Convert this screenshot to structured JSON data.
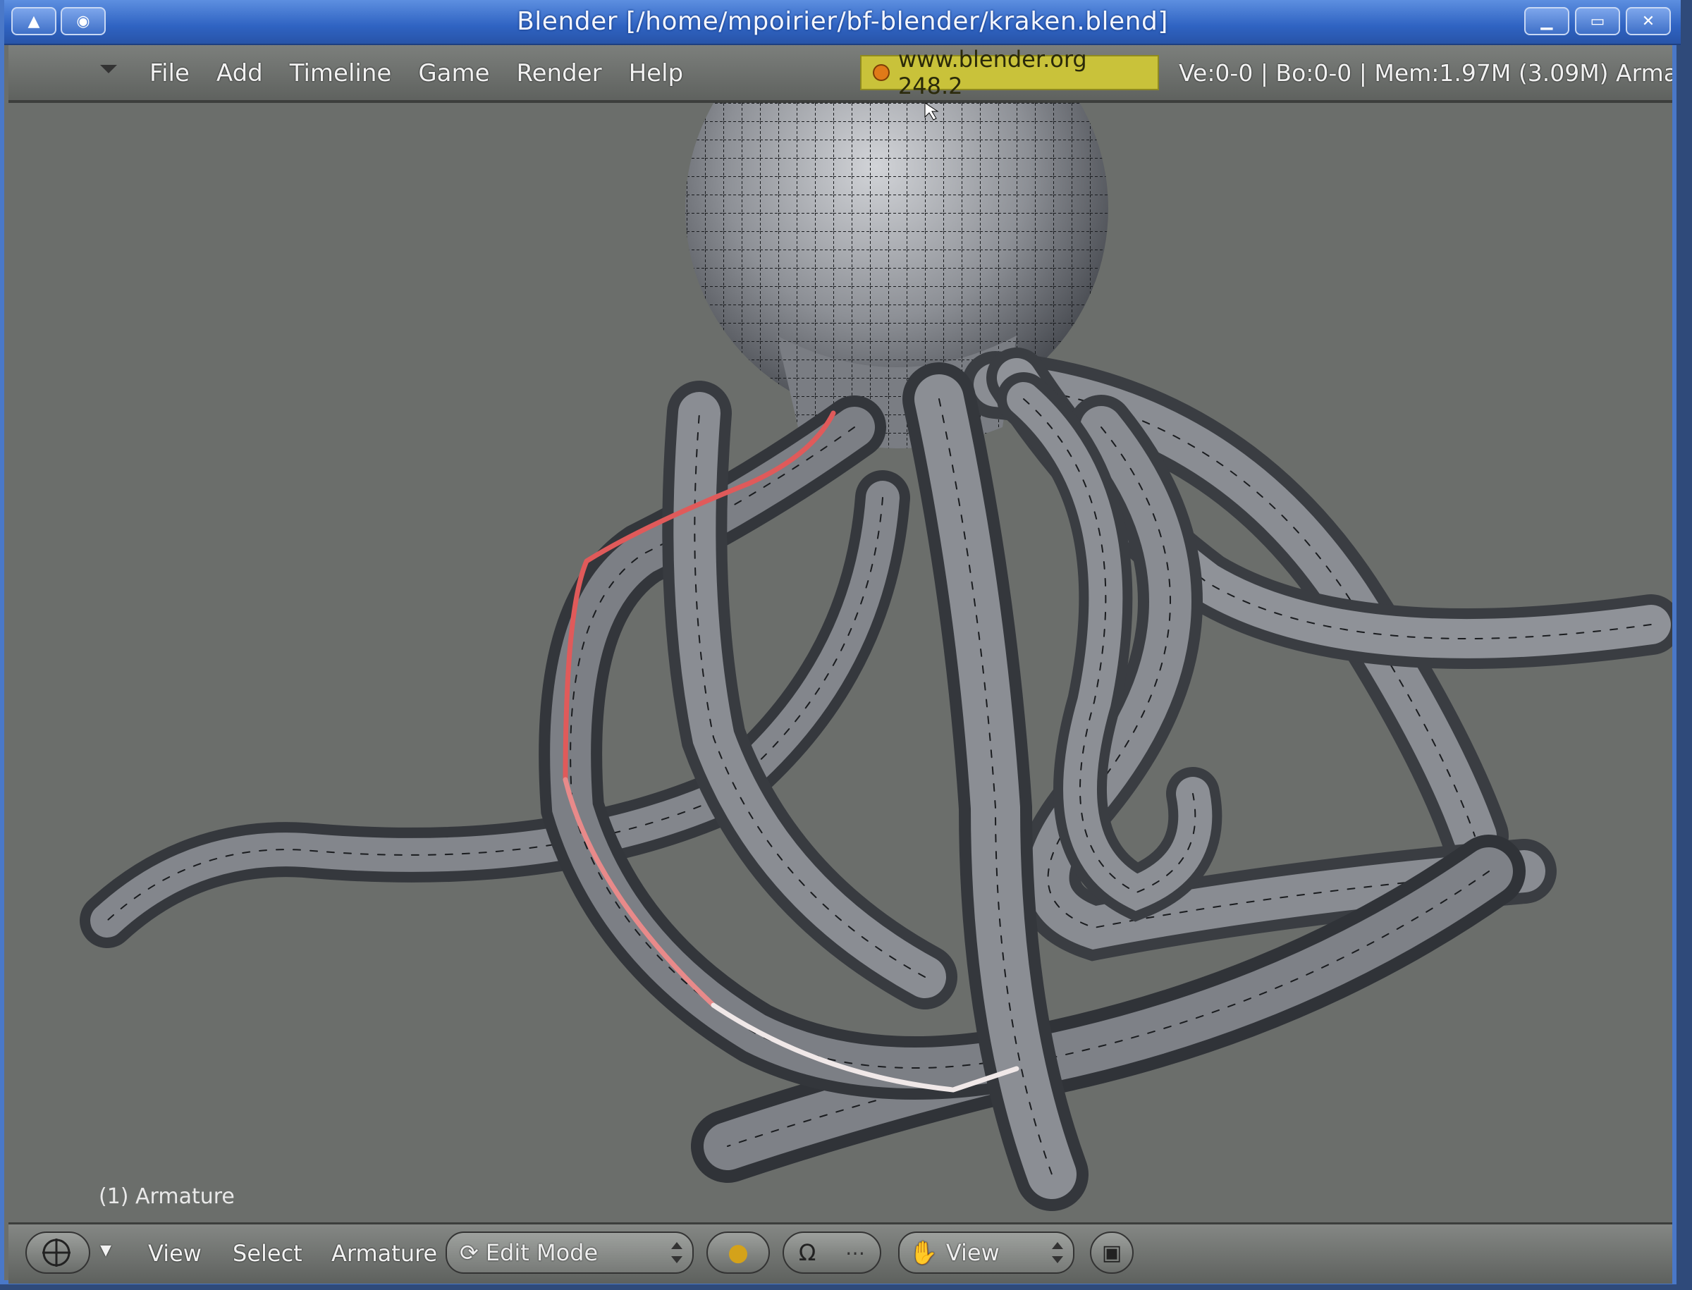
{
  "window": {
    "title": "Blender [/home/mpoirier/bf-blender/kraken.blend]"
  },
  "menubar": {
    "menus": [
      "File",
      "Add",
      "Timeline",
      "Game",
      "Render",
      "Help"
    ],
    "url_badge": "www.blender.org 248.2",
    "stats": "Ve:0-0 | Bo:0-0 | Mem:1.97M (3.09M) Arma"
  },
  "viewport": {
    "object_label": "(1) Armature",
    "background_color": "#6b6e6b",
    "mesh_color": "#3e4146",
    "bone_stroke_color": "#e05a5a"
  },
  "bottombar": {
    "view_label": "View",
    "select_label": "Select",
    "armature_label": "Armature",
    "mode_select": "Edit Mode",
    "orientation_select": "View"
  }
}
